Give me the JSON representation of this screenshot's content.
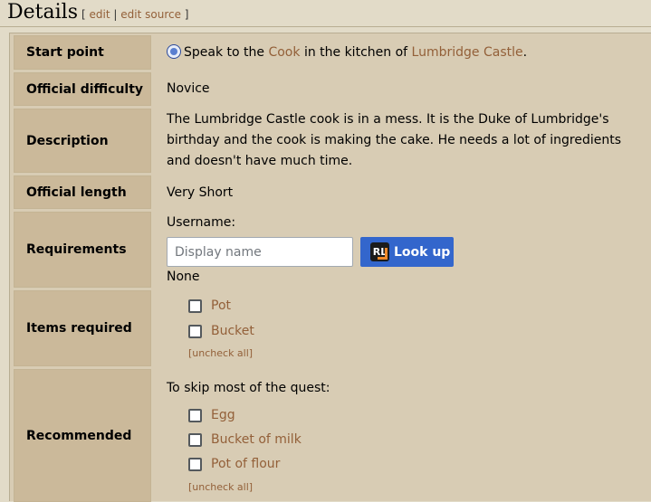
{
  "section": {
    "title": "Details",
    "edit_open": "[",
    "edit_label": "edit",
    "edit_sep": "|",
    "edit_source_label": "edit source",
    "edit_close": "]"
  },
  "rows": {
    "start_point": {
      "label": "Start point",
      "prefix": "Speak to the",
      "link1": "Cook",
      "middle": "in the kitchen of",
      "link2": "Lumbridge Castle",
      "suffix": "."
    },
    "difficulty": {
      "label": "Official difficulty",
      "value": "Novice"
    },
    "description": {
      "label": "Description",
      "value": "The Lumbridge Castle cook is in a mess. It is the Duke of Lumbridge's birthday and the cook is making the cake. He needs a lot of ingredients and doesn't have much time."
    },
    "length": {
      "label": "Official length",
      "value": "Very Short"
    },
    "requirements": {
      "label": "Requirements",
      "username_label": "Username:",
      "input_placeholder": "Display name",
      "input_value": "",
      "lookup_label": "Look up",
      "logo_text": "RL",
      "none_text": "None"
    },
    "items": {
      "label": "Items required",
      "list": [
        "Pot",
        "Bucket"
      ],
      "uncheck": "[uncheck all]"
    },
    "recommended": {
      "label": "Recommended",
      "intro": "To skip most of the quest:",
      "list": [
        "Egg",
        "Bucket of milk",
        "Pot of flour"
      ],
      "uncheck": "[uncheck all]"
    }
  },
  "colors": {
    "background": "#e2dbc8",
    "header_cell": "#cbb99a",
    "link": "#936039",
    "button": "#3366cc"
  }
}
